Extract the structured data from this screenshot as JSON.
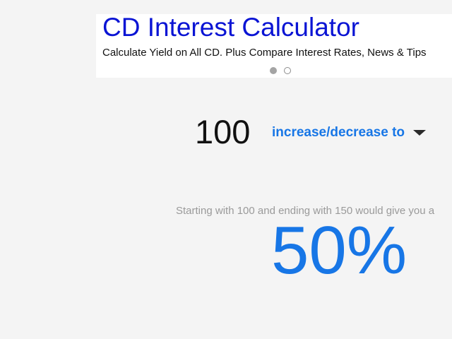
{
  "ad": {
    "title": "CD Interest Calculator",
    "subtitle": "Calculate Yield on All CD. Plus Compare Interest Rates, News & Tips",
    "slides": [
      "active",
      "inactive"
    ]
  },
  "calculator": {
    "start_value": "100",
    "mode_label": "increase/decrease to",
    "explanation": "Starting with 100 and ending with 150 would give you a",
    "result": "50%"
  },
  "colors": {
    "ad_title": "#0a14d4",
    "accent": "#1776e6",
    "background": "#f4f4f4",
    "muted_text": "#9a9a9a"
  }
}
